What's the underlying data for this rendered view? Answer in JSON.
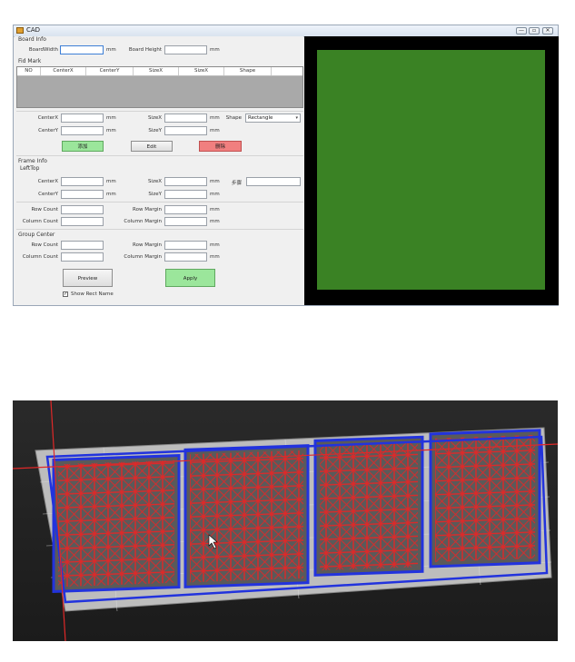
{
  "window": {
    "title": "CAD",
    "controls": {
      "minimize": "—",
      "maximize": "▫",
      "close": "✕"
    }
  },
  "board_info": {
    "section": "Board Info",
    "width_label": "BoardWidth",
    "width_value": "",
    "height_label": "Board Height",
    "height_value": "",
    "unit": "mm"
  },
  "fid_mark": {
    "section": "Fid Mark",
    "columns": [
      "NO",
      "CenterX",
      "CenterY",
      "SizeX",
      "SizeX",
      "Shape"
    ],
    "centerx_label": "CenterX",
    "centery_label": "CenterY",
    "sizex_label": "SizeX",
    "sizey_label": "SizeY",
    "shape_label": "Shape",
    "shape_value": "Rectangle",
    "unit": "mm",
    "add_button": "添加",
    "edit_button": "Edit",
    "delete_button": "删除"
  },
  "frame_info": {
    "section": "Frame Info",
    "lefttop_label": "LeftTop",
    "centerx_label": "CenterX",
    "centery_label": "CenterY",
    "sizex_label": "SizeX",
    "sizey_label": "SizeY",
    "step_label": "步骤",
    "row_count_label": "Row Count",
    "column_count_label": "Column Count",
    "row_margin_label": "Row Margin",
    "column_margin_label": "Column Margin",
    "unit": "mm"
  },
  "group_center": {
    "section": "Group Center",
    "row_count_label": "Row Count",
    "column_count_label": "Column Count",
    "row_margin_label": "Row Margin",
    "column_margin_label": "Column Margin",
    "unit": "mm"
  },
  "actions": {
    "preview_button": "Preview",
    "apply_button": "Apply",
    "show_rect_name_label": "Show Rect Name",
    "show_rect_name_checked": true
  },
  "colors": {
    "preview_bg": "#000000",
    "preview_board": "#3a8224",
    "add_green": "#9be69b",
    "delete_red": "#f17f7f",
    "tray_red": "#e02828",
    "tray_blue": "#2233dd"
  }
}
